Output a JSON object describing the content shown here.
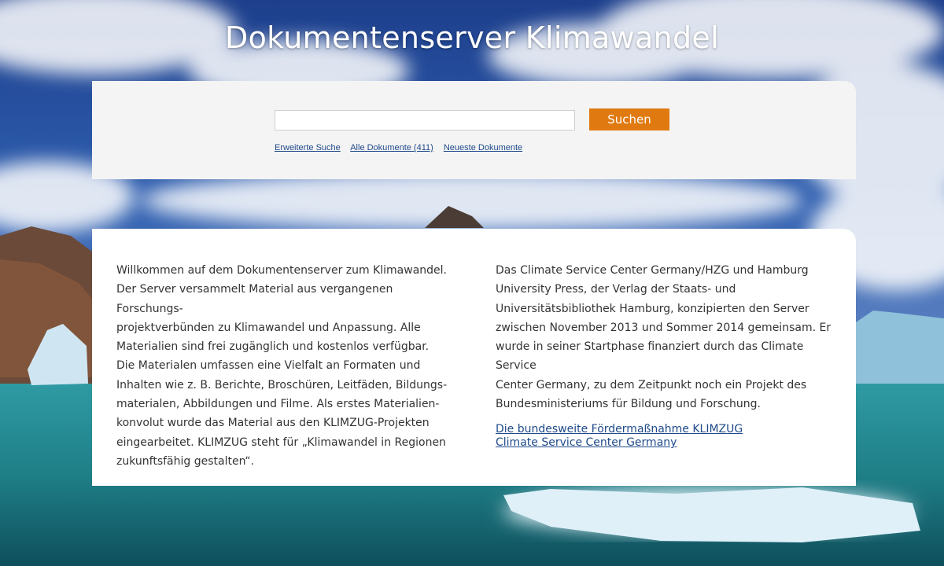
{
  "site": {
    "title": "Dokumentenserver Klimawandel"
  },
  "search": {
    "input_value": "",
    "placeholder": "",
    "button_label": "Suchen",
    "links": [
      "Erweiterte Suche",
      "Alle Dokumente (411)",
      "Neueste Dokumente"
    ]
  },
  "content": {
    "left_lines": [
      "Willkommen auf dem Dokumentenserver zum Klimawandel.",
      "Der Server versammelt Material aus vergangenen Forschungs-",
      "projektverbünden zu Klimawandel und Anpassung. Alle",
      "Materialien sind frei zugänglich und kostenlos verfügbar.",
      "Die Materialen umfassen eine Vielfalt an Formaten und",
      "Inhalten wie z. B. Berichte, Broschüren, Leitfäden, Bildungs-",
      "materialen, Abbildungen und Filme. Als erstes Materialien-",
      "konvolut wurde das Material aus den KLIMZUG-Projekten",
      "eingearbeitet. KLIMZUG steht für „Klimawandel in Regionen",
      "zukunftsfähig gestalten“."
    ],
    "right_lines": [
      "Das Climate Service Center Germany/HZG und Hamburg",
      "University Press, der Verlag der Staats- und",
      "Universitätsbibliothek Hamburg, konzipierten den Server",
      "zwischen November 2013 und Sommer 2014 gemeinsam. Er",
      "wurde in seiner Startphase finanziert durch das Climate Service",
      "Center Germany, zu dem Zeitpunkt noch ein Projekt des",
      "Bundesministeriums für Bildung und Forschung."
    ],
    "links": [
      "Die bundesweite Fördermaßnahme KLIMZUG",
      "Climate Service Center Germany"
    ]
  },
  "colors": {
    "accent_button": "#e07a10",
    "link": "#1f4a8a",
    "panel_bg": "#f4f4f4"
  }
}
